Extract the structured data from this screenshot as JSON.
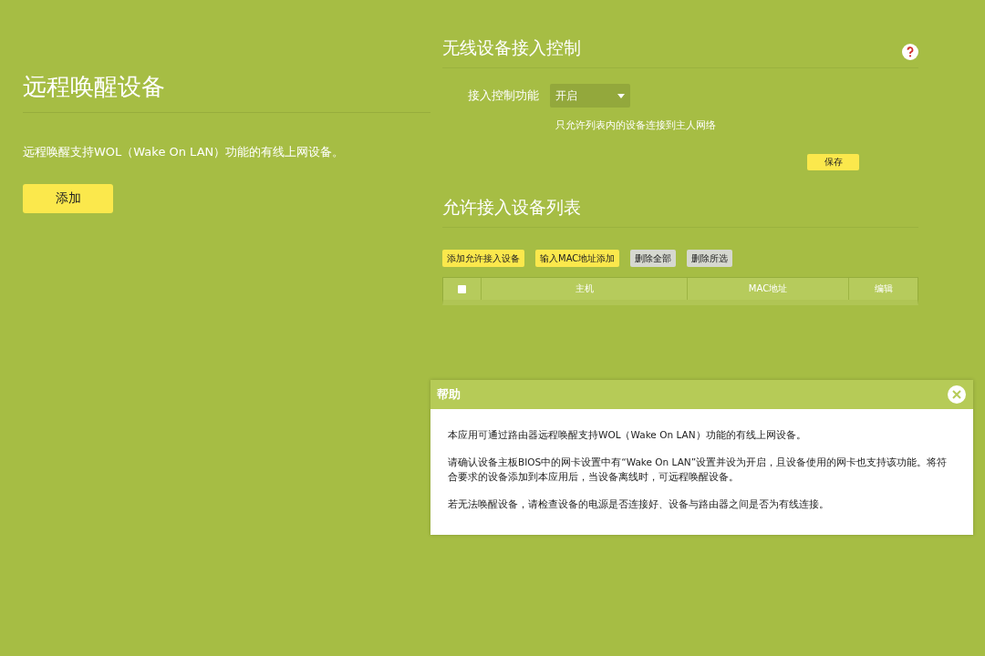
{
  "left": {
    "title": "远程唤醒设备",
    "description": "远程唤醒支持WOL（Wake On LAN）功能的有线上网设备。",
    "add_button": "添加"
  },
  "access_control": {
    "title": "无线设备接入控制",
    "field_label": "接入控制功能",
    "select_value": "开启",
    "hint": "只允许列表内的设备连接到主人网络",
    "save_button": "保存"
  },
  "allowed_list": {
    "title": "允许接入设备列表",
    "buttons": [
      {
        "label": "添加允许接入设备",
        "kind": "primary"
      },
      {
        "label": "输入MAC地址添加",
        "kind": "primary"
      },
      {
        "label": "删除全部",
        "kind": "secondary"
      },
      {
        "label": "删除所选",
        "kind": "secondary"
      }
    ],
    "table": {
      "select_all_checked": false,
      "columns": [
        "主机",
        "MAC地址",
        "编辑"
      ]
    }
  },
  "help_dialog": {
    "title": "帮助",
    "paragraphs": [
      "本应用可通过路由器远程唤醒支持WOL（Wake On LAN）功能的有线上网设备。",
      "请确认设备主板BIOS中的网卡设置中有“Wake On LAN”设置并设为开启，且设备使用的网卡也支持该功能。将符合要求的设备添加到本应用后，当设备离线时，可远程唤醒设备。",
      "若无法唤醒设备，请检查设备的电源是否连接好、设备与路由器之间是否为有线连接。"
    ]
  }
}
